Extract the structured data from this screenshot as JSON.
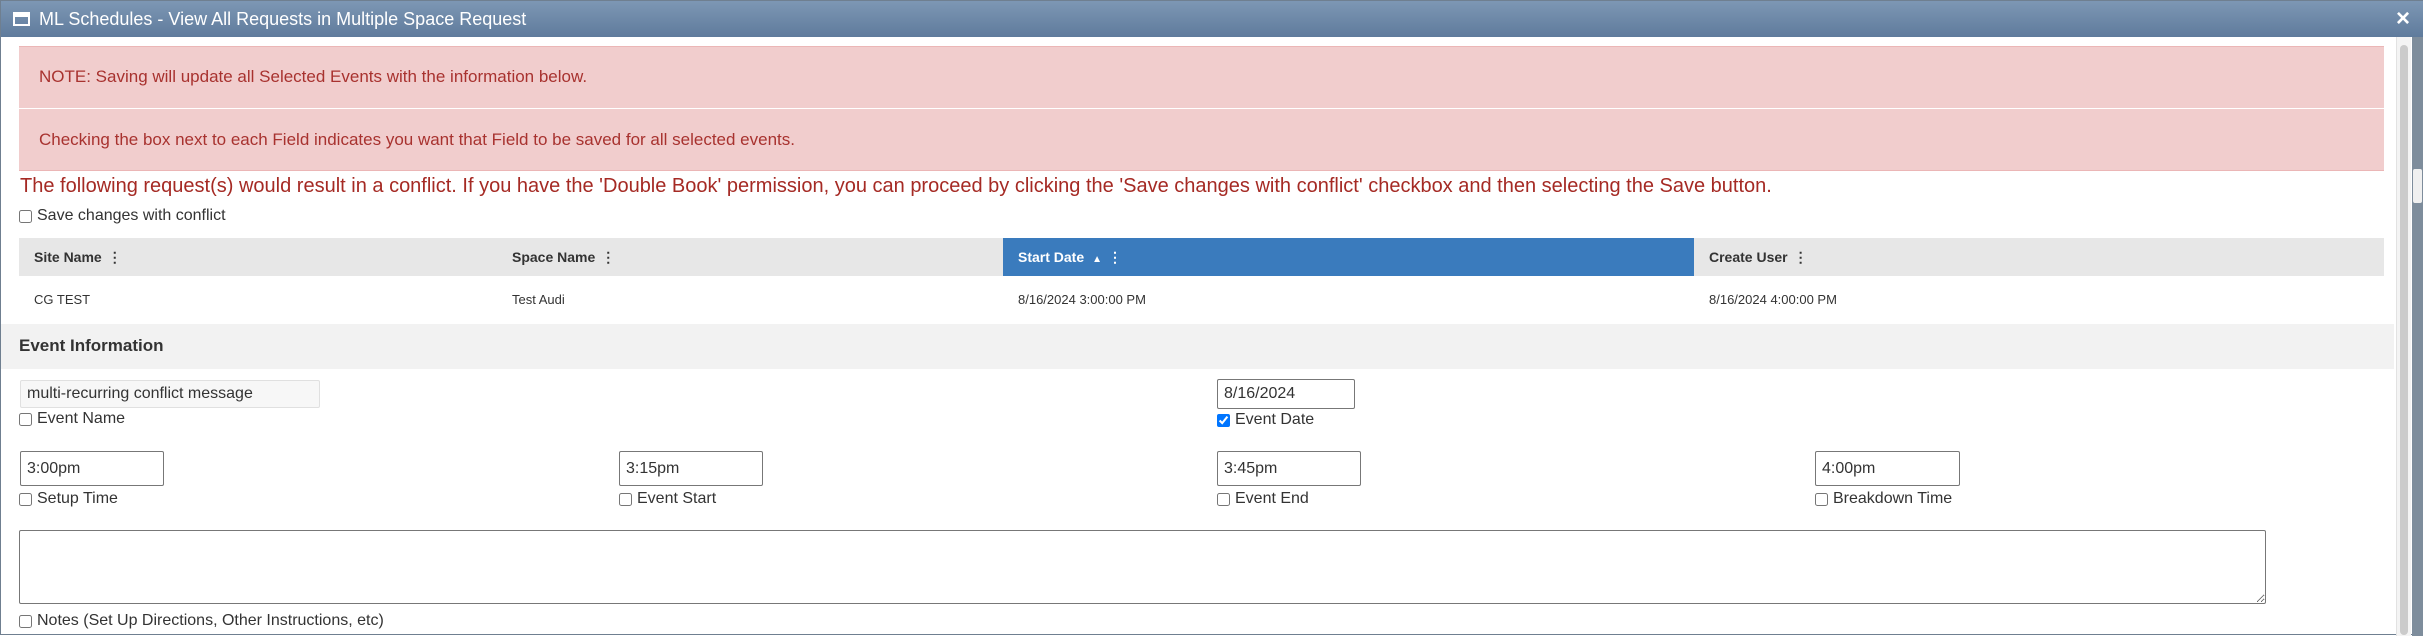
{
  "window": {
    "title": "ML Schedules - View All Requests in Multiple Space Request",
    "close_glyph": "×"
  },
  "notices": {
    "note1": "NOTE: Saving will update all Selected Events with the information below.",
    "note2": "Checking the box next to each Field indicates you want that Field to be saved for all selected events.",
    "conflict": "The following request(s) would result in a conflict. If you have the 'Double Book' permission, you can proceed by clicking the 'Save changes with conflict' checkbox and then selecting the Save button."
  },
  "save_conflict": {
    "label": "Save changes with conflict",
    "checked": false
  },
  "grid": {
    "columns": [
      {
        "label": "Site Name"
      },
      {
        "label": "Space Name"
      },
      {
        "label": "Start Date",
        "sorted": "asc"
      },
      {
        "label": "Create User"
      }
    ],
    "rows": [
      {
        "site": "CG TEST",
        "space": "Test Audi",
        "start": "8/16/2024 3:00:00 PM",
        "create": "8/16/2024 4:00:00 PM"
      }
    ]
  },
  "event_info": {
    "heading": "Event Information",
    "event_name": {
      "value": "multi-recurring conflict message",
      "label": "Event Name",
      "checked": false
    },
    "event_date": {
      "value": "8/16/2024",
      "label": "Event Date",
      "checked": true
    },
    "setup_time": {
      "value": "3:00pm",
      "label": "Setup Time",
      "checked": false
    },
    "event_start": {
      "value": "3:15pm",
      "label": "Event Start",
      "checked": false
    },
    "event_end": {
      "value": "3:45pm",
      "label": "Event End",
      "checked": false
    },
    "breakdown_time": {
      "value": "4:00pm",
      "label": "Breakdown Time",
      "checked": false
    },
    "notes": {
      "value": "",
      "label": "Notes (Set Up Directions, Other Instructions, etc)",
      "checked": false
    }
  },
  "colors": {
    "titlebar": "#6b86a6",
    "note_bg": "#f1cdcd",
    "note_text": "#a8322f",
    "conflict_text": "#a52a24",
    "active_header": "#3a7bbd",
    "arrow": "#e53935"
  },
  "icons": {
    "window": "window-icon",
    "column_menu": "column-menu-icon",
    "sort": "sort-ascending-icon",
    "annotation": "red-arrow-annotation"
  }
}
